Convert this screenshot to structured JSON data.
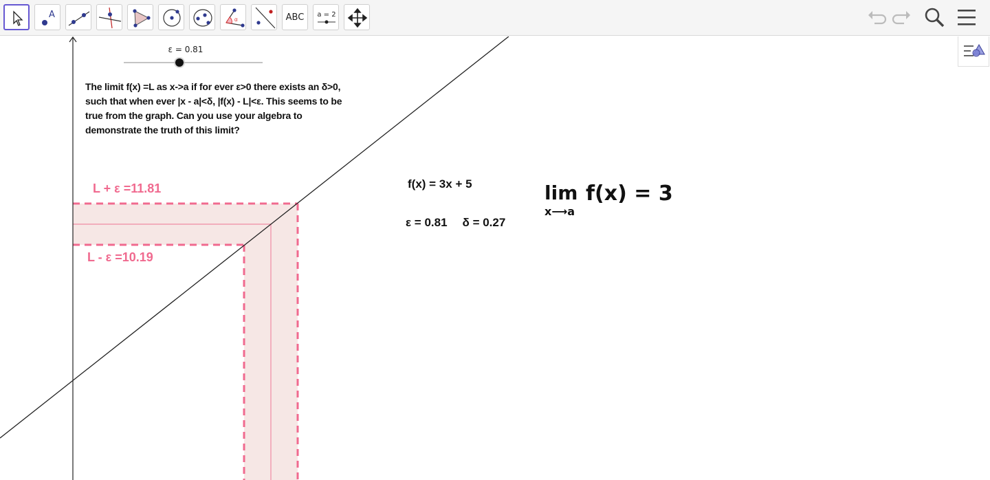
{
  "toolbar": {
    "tools": [
      {
        "id": "move",
        "label": "",
        "icon": "move-pointer-icon"
      },
      {
        "id": "point",
        "label": "A",
        "icon": "point-icon"
      },
      {
        "id": "line",
        "label": "",
        "icon": "line-icon"
      },
      {
        "id": "perpendicular",
        "label": "",
        "icon": "perpendicular-line-icon"
      },
      {
        "id": "polygon",
        "label": "",
        "icon": "polygon-icon"
      },
      {
        "id": "circle",
        "label": "",
        "icon": "circle-center-point-icon"
      },
      {
        "id": "ellipse",
        "label": "",
        "icon": "conic-icon"
      },
      {
        "id": "angle",
        "label": "",
        "icon": "angle-icon"
      },
      {
        "id": "reflect",
        "label": "",
        "icon": "reflect-icon"
      },
      {
        "id": "text",
        "label": "ABC",
        "icon": "text-icon"
      },
      {
        "id": "slider",
        "label": "a = 2",
        "icon": "slider-icon"
      },
      {
        "id": "move-view",
        "label": "",
        "icon": "move-graphics-view-icon"
      }
    ],
    "right": [
      "undo-icon",
      "redo-icon",
      "search-icon",
      "menu-icon"
    ]
  },
  "slider": {
    "label": "ε = 0.81",
    "value": 0.81
  },
  "description": "The limit f(x) =L as x->a if for ever ε>0 there exists an δ>0, such that when ever |x - a|<δ, |f(x) - L|<ε.  This seems to be true from the graph.  Can you use your algebra to demonstrate the truth of this limit?",
  "labels": {
    "upper": "L + ε =11.81",
    "lower": "L - ε =10.19"
  },
  "function": "f(x) =  3x + 5",
  "epsilon": "ε = 0.81",
  "delta": "δ = 0.27",
  "limit": {
    "word": "lim",
    "sub": "x⟶a",
    "expr": "f(x) =  3"
  },
  "colors": {
    "accent": "#6557d2",
    "band_fill": "#f6e7e5",
    "band_stroke": "#f06a8f"
  }
}
